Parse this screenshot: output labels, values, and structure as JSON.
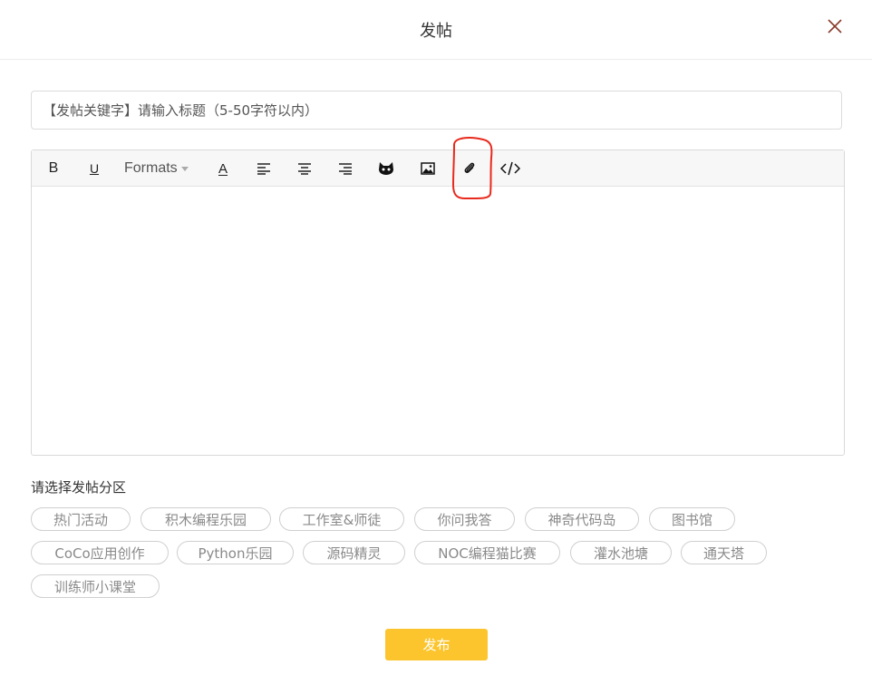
{
  "header": {
    "title": "发帖",
    "close_icon": "close-icon"
  },
  "title_input": {
    "placeholder": "【发帖关键字】请输入标题（5-50字符以内）",
    "value": ""
  },
  "toolbar": {
    "bold": "B",
    "underline": "U",
    "formats": "Formats",
    "font_color": "A",
    "icons": [
      "align-left-icon",
      "align-center-icon",
      "align-right-icon",
      "emoji-cat-icon",
      "image-icon",
      "attachment-icon",
      "code-icon"
    ]
  },
  "editor": {
    "content": ""
  },
  "annotation": {
    "color": "#e8291c"
  },
  "categories": {
    "label": "请选择发帖分区",
    "tags": [
      "热门活动",
      "积木编程乐园",
      "工作室&师徒",
      "你问我答",
      "神奇代码岛",
      "图书馆",
      "CoCo应用创作",
      "Python乐园",
      "源码精灵",
      "NOC编程猫比赛",
      "灌水池塘",
      "通天塔",
      "训练师小课堂"
    ]
  },
  "submit": {
    "label": "发布",
    "color": "#fcc52e"
  }
}
